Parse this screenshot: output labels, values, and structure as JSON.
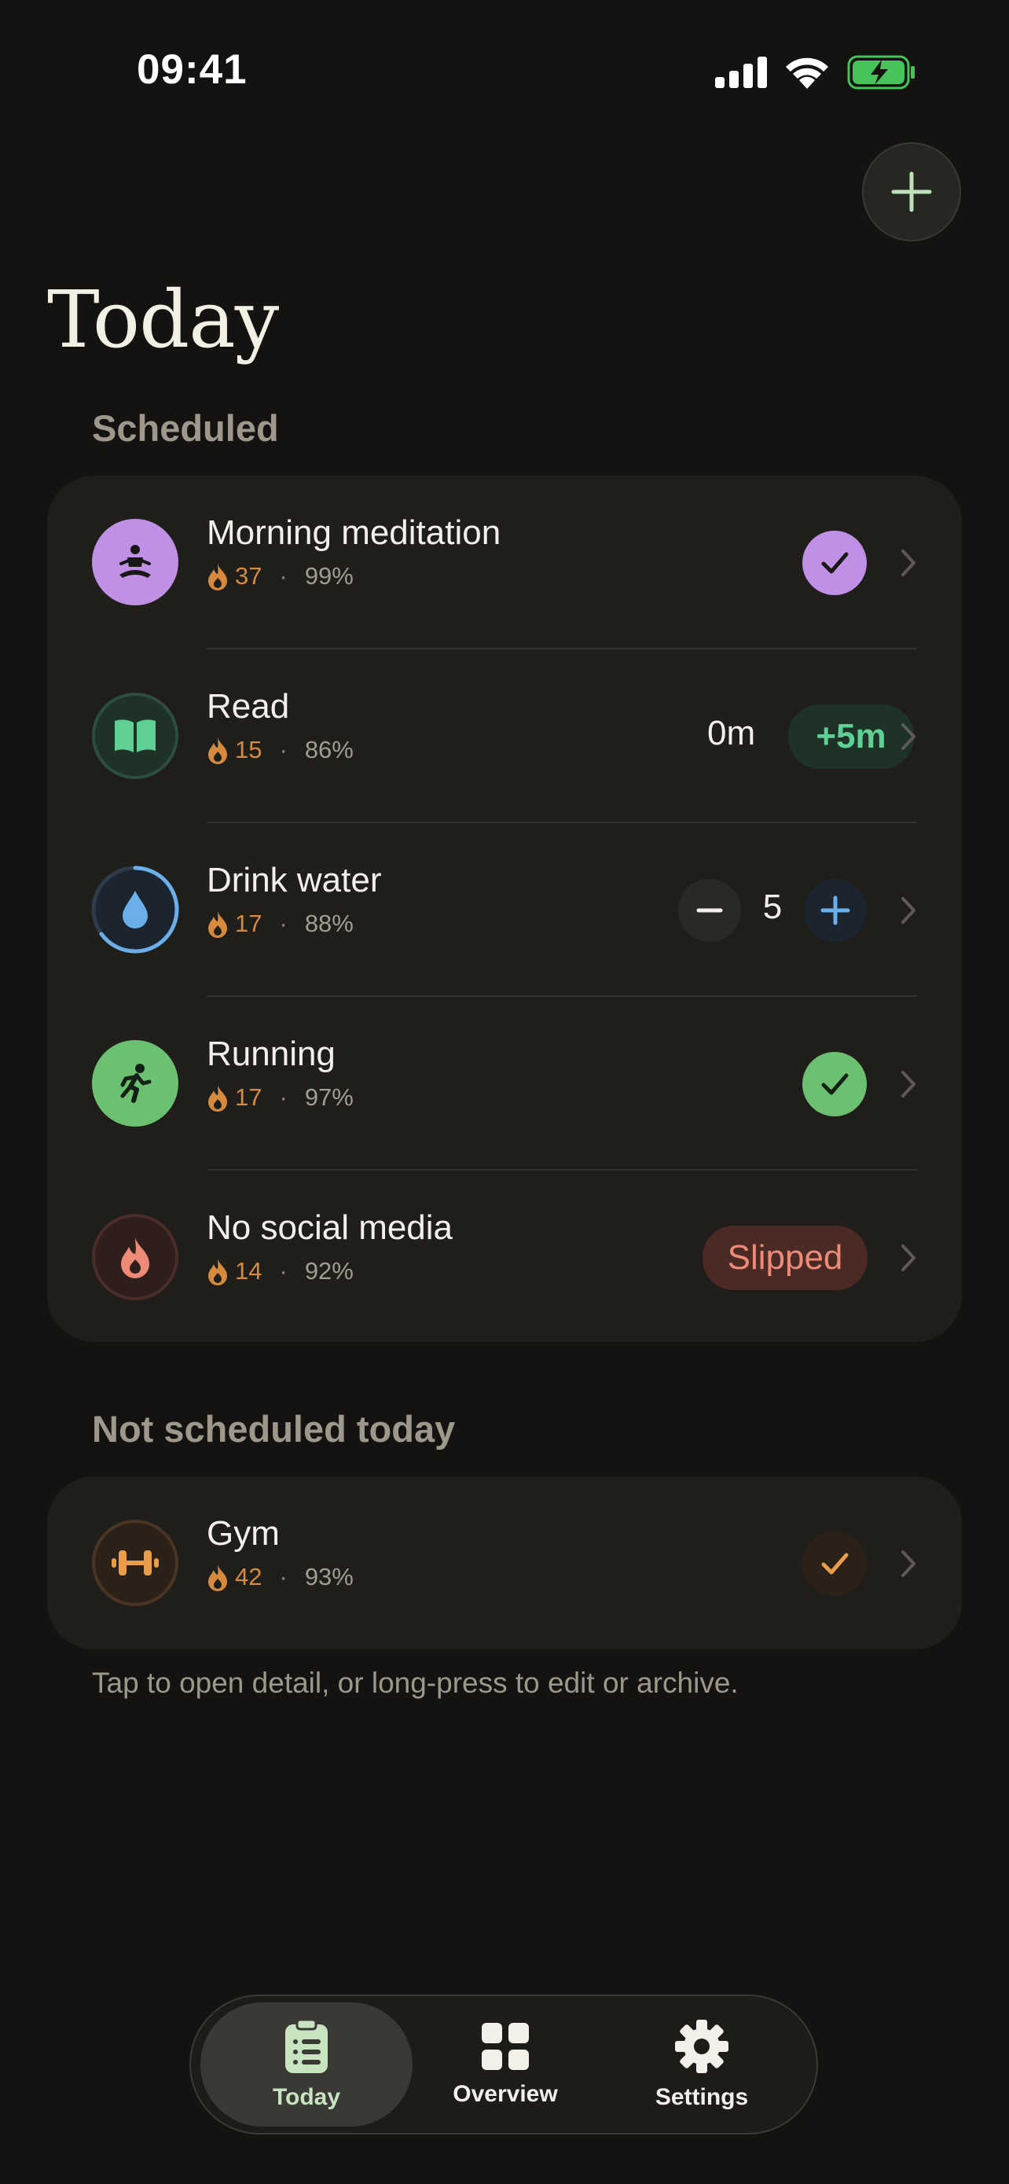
{
  "status_bar": {
    "time": "09:41",
    "icons": [
      "cellular-signal-icon",
      "wifi-icon",
      "battery-charging-icon"
    ]
  },
  "header": {
    "title": "Today",
    "add_icon": "plus-icon"
  },
  "sections": {
    "scheduled_label": "Scheduled",
    "not_scheduled_label": "Not scheduled today"
  },
  "habits": {
    "meditation": {
      "name": "Morning meditation",
      "streak": "37",
      "rate": "99%",
      "icon": "meditation-icon",
      "color": "#c08fe6",
      "state": "done"
    },
    "read": {
      "name": "Read",
      "streak": "15",
      "rate": "86%",
      "icon": "book-icon",
      "color": "#5fcf95",
      "value": "0m",
      "increment": "+5m"
    },
    "water": {
      "name": "Drink water",
      "streak": "17",
      "rate": "88%",
      "icon": "water-drop-icon",
      "color": "#6aaeea",
      "count": "5",
      "progress": 0.65
    },
    "running": {
      "name": "Running",
      "streak": "17",
      "rate": "97%",
      "icon": "running-icon",
      "color": "#6cc071",
      "state": "done"
    },
    "social": {
      "name": "No social media",
      "streak": "14",
      "rate": "92%",
      "icon": "flame-icon",
      "color": "#ee8a78",
      "status": "Slipped"
    },
    "gym": {
      "name": "Gym",
      "streak": "42",
      "rate": "93%",
      "icon": "dumbbell-icon",
      "color": "#e99c4a",
      "state": "done"
    }
  },
  "separator": "·",
  "hint": "Tap to open detail, or long-press to edit or archive.",
  "tabbar": {
    "today": "Today",
    "overview": "Overview",
    "settings": "Settings",
    "active": "today"
  }
}
